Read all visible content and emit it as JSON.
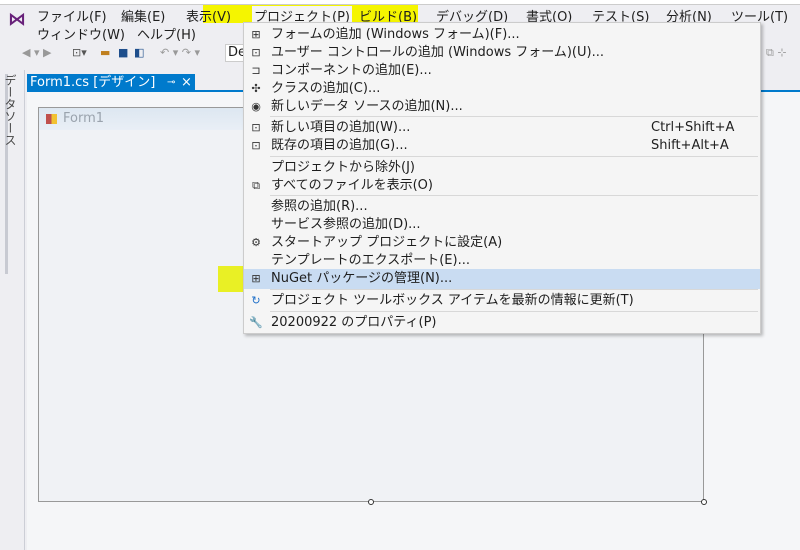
{
  "menubar": {
    "row1": [
      "ファイル(F)",
      "編集(E)",
      "表示(V)",
      "プロジェクト(P)",
      "ビルド(B)",
      "デバッグ(D)",
      "書式(O)",
      "テスト(S)",
      "分析(N)",
      "ツール(T)"
    ],
    "row2": [
      "ウィンドウ(W)",
      "ヘルプ(H)"
    ]
  },
  "toolbar": {
    "config": "De"
  },
  "side_tab": "データソース",
  "doc_tab": {
    "label": "Form1.cs [デザイン]",
    "pin": "⊸",
    "close": "×"
  },
  "form": {
    "title": "Form1"
  },
  "accent": "#007acc",
  "highlight": "#f5f500",
  "project_menu": [
    {
      "label": "フォームの追加 (Windows フォーム)(F)...",
      "icon": "add-form-icon"
    },
    {
      "label": "ユーザー コントロールの追加 (Windows フォーム)(U)...",
      "icon": "add-user-control-icon"
    },
    {
      "label": "コンポーネントの追加(E)...",
      "icon": "add-component-icon"
    },
    {
      "label": "クラスの追加(C)...",
      "icon": "add-class-icon"
    },
    {
      "label": "新しいデータ ソースの追加(N)...",
      "icon": "add-datasource-icon"
    },
    {
      "label": "新しい項目の追加(W)...",
      "shortcut": "Ctrl+Shift+A",
      "icon": "new-item-icon"
    },
    {
      "label": "既存の項目の追加(G)...",
      "shortcut": "Shift+Alt+A",
      "icon": "existing-item-icon"
    },
    {
      "label": "プロジェクトから除外(J)"
    },
    {
      "label": "すべてのファイルを表示(O)",
      "icon": "show-all-files-icon"
    },
    {
      "label": "参照の追加(R)..."
    },
    {
      "label": "サービス参照の追加(D)..."
    },
    {
      "label": "スタートアップ プロジェクトに設定(A)",
      "icon": "gear-icon"
    },
    {
      "label": "テンプレートのエクスポート(E)..."
    },
    {
      "label": "NuGet パッケージの管理(N)...",
      "icon": "nuget-icon"
    },
    {
      "label": "プロジェクト ツールボックス アイテムを最新の情報に更新(T)",
      "icon": "refresh-icon"
    },
    {
      "label": "20200922 のプロパティ(P)",
      "icon": "wrench-icon"
    }
  ]
}
